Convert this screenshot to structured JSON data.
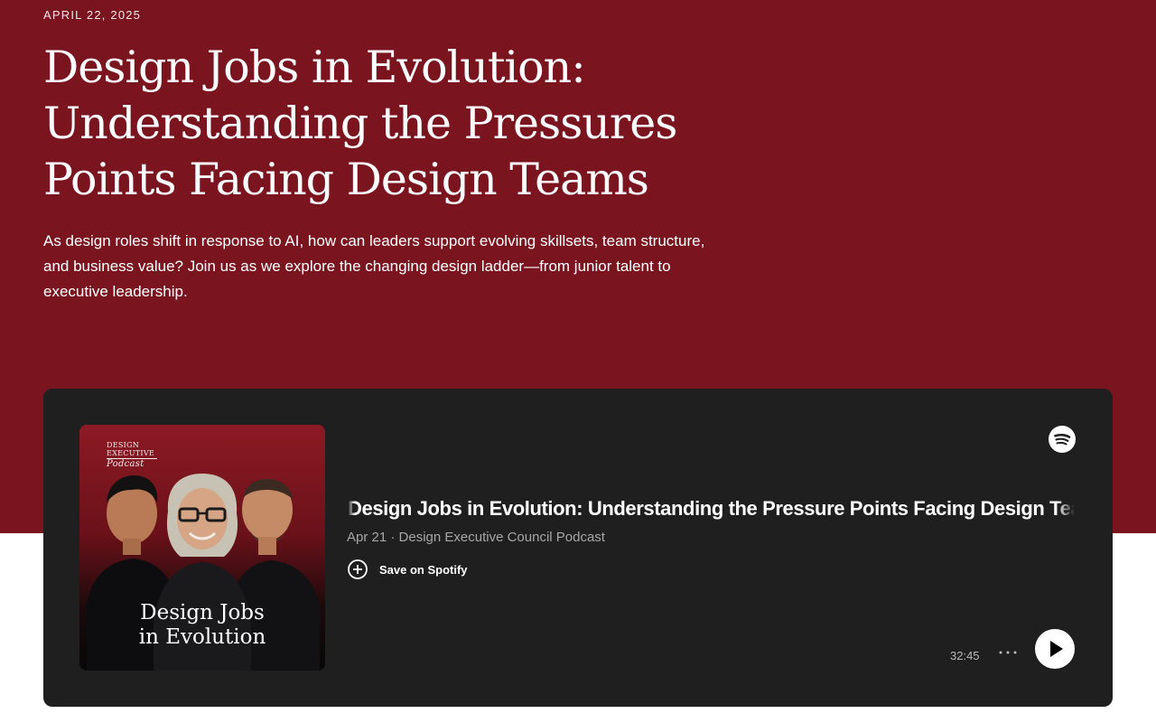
{
  "hero": {
    "date": "APRIL 22, 2025",
    "title_lines": [
      "Design Jobs in Evolution:",
      "Understanding the Pressures",
      "Points Facing Design Teams"
    ],
    "subtitle": "As design roles shift in response to AI, how can leaders support evolving skillsets, team structure, and business value? Join us as we explore the changing design ladder—from junior talent to executive leadership."
  },
  "player": {
    "cover": {
      "brand_line1": "DESIGN",
      "brand_line2": "EXECUTIVE",
      "brand_line3": "Podcast",
      "title_line1": "Design Jobs",
      "title_line2": "in Evolution"
    },
    "spotify_icon": "spotify-logo",
    "episode_title": "Design Jobs in Evolution: Understanding the Pressure Points Facing Design Teams",
    "meta": "Apr 21 · Design Executive Council Podcast",
    "save_label": "Save on Spotify",
    "duration": "32:45",
    "more_icon": "more-horizontal",
    "play_icon": "play"
  },
  "colors": {
    "hero_bg": "#7a1520",
    "player_bg": "#1f1f1f",
    "text_muted": "#a7a7a7"
  }
}
